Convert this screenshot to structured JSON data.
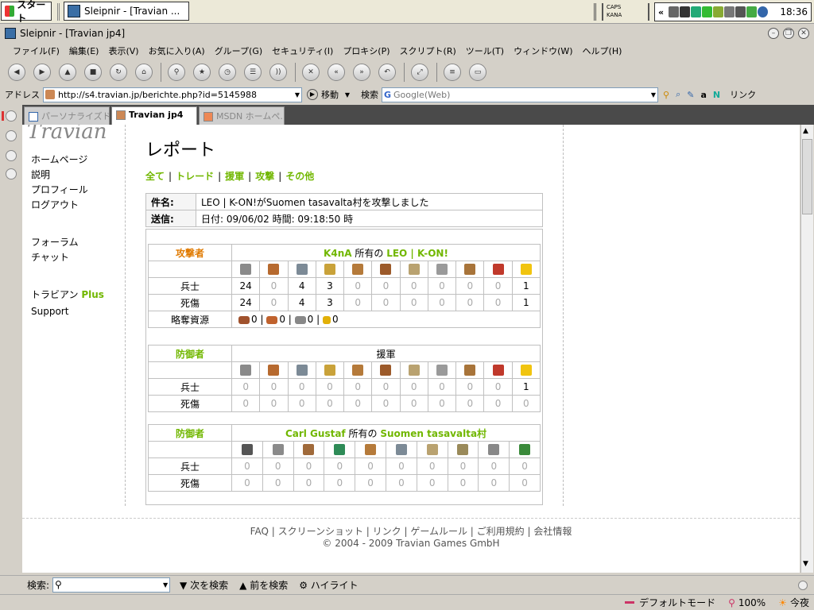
{
  "taskbar": {
    "start_label": "スタート",
    "task_label": "Sleipnir - [Travian ...",
    "caps": "CAPS",
    "kana": "KANA",
    "clock": "18:36",
    "tray_prefix": "«"
  },
  "window": {
    "title": "Sleipnir - [Travian jp4]"
  },
  "menu": [
    "ファイル(F)",
    "編集(E)",
    "表示(V)",
    "お気に入り(A)",
    "グループ(G)",
    "セキュリティ(I)",
    "プロキシ(P)",
    "スクリプト(R)",
    "ツール(T)",
    "ウィンドウ(W)",
    "ヘルプ(H)"
  ],
  "address": {
    "label": "アドレス",
    "url": "http://s4.travian.jp/berichte.php?id=5145988",
    "go_label": "移動",
    "search_label": "検索",
    "search_engine": "Google(Web)",
    "links_label": "リンク"
  },
  "tabs": [
    {
      "label": "パーソナライズド..."
    },
    {
      "label": "Travian jp4"
    },
    {
      "label": "MSDN ホームペ..."
    }
  ],
  "nav": {
    "items_a": [
      "ホームページ",
      "説明",
      "プロフィール",
      "ログアウト"
    ],
    "items_b": [
      "フォーラム",
      "チャット"
    ],
    "travian_plus_prefix": "トラビアン",
    "travian_plus_suffix": "Plus",
    "support": "Support"
  },
  "report": {
    "heading": "レポート",
    "filters": [
      "全て",
      "トレード",
      "援軍",
      "攻撃",
      "その他"
    ],
    "subject_label": "件名:",
    "subject": "LEO | K-ON!がSuomen tasavalta村を攻撃しました",
    "sent_label": "送信:",
    "sent": "日付: 09/06/02 時間: 09:18:50 時",
    "attacker": {
      "label": "攻撃者",
      "player": "K4nA",
      "owner_word": "所有の",
      "village": "LEO | K-ON!",
      "troops_label": "兵士",
      "troops": [
        24,
        0,
        4,
        3,
        0,
        0,
        0,
        0,
        0,
        0,
        1
      ],
      "casualties_label": "死傷",
      "casualties": [
        24,
        0,
        4,
        3,
        0,
        0,
        0,
        0,
        0,
        0,
        1
      ],
      "bounty_label": "略奪資源",
      "bounty": [
        0,
        0,
        0,
        0
      ]
    },
    "defender1": {
      "label": "防御者",
      "title": "援軍",
      "troops_label": "兵士",
      "troops": [
        0,
        0,
        0,
        0,
        0,
        0,
        0,
        0,
        0,
        0,
        1
      ],
      "casualties_label": "死傷",
      "casualties": [
        0,
        0,
        0,
        0,
        0,
        0,
        0,
        0,
        0,
        0,
        0
      ]
    },
    "defender2": {
      "label": "防御者",
      "player": "Carl Gustaf",
      "owner_word": "所有の",
      "village": "Suomen tasavalta村",
      "troops_label": "兵士",
      "troops": [
        0,
        0,
        0,
        0,
        0,
        0,
        0,
        0,
        0,
        0
      ],
      "casualties_label": "死傷",
      "casualties": [
        0,
        0,
        0,
        0,
        0,
        0,
        0,
        0,
        0,
        0
      ]
    }
  },
  "footer": {
    "links": [
      "FAQ",
      "スクリーンショット",
      "リンク",
      "ゲームルール",
      "ご利用規約",
      "会社情報"
    ],
    "copyright": "© 2004 - 2009 Travian Games GmbH"
  },
  "findbar": {
    "label": "検索:",
    "next": "次を検索",
    "prev": "前を検索",
    "highlight": "ハイライト"
  },
  "status": {
    "mode": "デフォルトモード",
    "zoom": "100%",
    "today": "今夜"
  },
  "colors": {
    "travian_green": "#71b700",
    "attacker_orange": "#e07a00"
  }
}
